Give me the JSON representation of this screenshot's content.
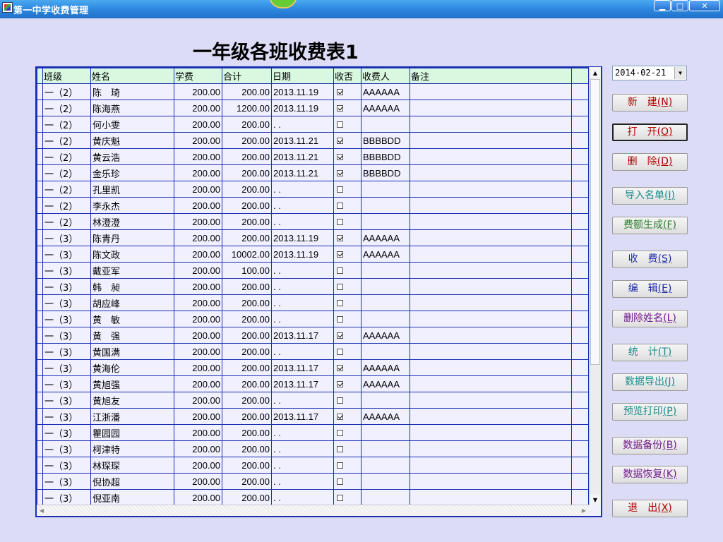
{
  "window": {
    "title": "第一中学收费管理",
    "minimize": "▁",
    "maximize": "□",
    "close": "✕"
  },
  "page_title": "一年级各班收费表1",
  "date_picker": {
    "value": "2014-02-21",
    "arrow": "▼"
  },
  "grid": {
    "columns": [
      "班级",
      "姓名",
      "学费",
      "合计",
      "日期",
      "收否",
      "收费人",
      "备注"
    ],
    "rows": [
      {
        "cls": "一（2）",
        "name": "陈　琦",
        "fee": "200.00",
        "total": "200.00",
        "date": "2013.11.19",
        "paid": true,
        "payer": "AAAAAA",
        "note": ""
      },
      {
        "cls": "一（2）",
        "name": "陈海燕",
        "fee": "200.00",
        "total": "1200.00",
        "date": "2013.11.19",
        "paid": true,
        "payer": "AAAAAA",
        "note": ""
      },
      {
        "cls": "一（2）",
        "name": "何小雯",
        "fee": "200.00",
        "total": "200.00",
        "date": ". .",
        "paid": false,
        "payer": "",
        "note": ""
      },
      {
        "cls": "一（2）",
        "name": "黄庆魁",
        "fee": "200.00",
        "total": "200.00",
        "date": "2013.11.21",
        "paid": true,
        "payer": "BBBBDD",
        "note": ""
      },
      {
        "cls": "一（2）",
        "name": "黄云浩",
        "fee": "200.00",
        "total": "200.00",
        "date": "2013.11.21",
        "paid": true,
        "payer": "BBBBDD",
        "note": ""
      },
      {
        "cls": "一（2）",
        "name": "金乐珍",
        "fee": "200.00",
        "total": "200.00",
        "date": "2013.11.21",
        "paid": true,
        "payer": "BBBBDD",
        "note": ""
      },
      {
        "cls": "一（2）",
        "name": "孔里凯",
        "fee": "200.00",
        "total": "200.00",
        "date": ". .",
        "paid": false,
        "payer": "",
        "note": ""
      },
      {
        "cls": "一（2）",
        "name": "李永杰",
        "fee": "200.00",
        "total": "200.00",
        "date": ". .",
        "paid": false,
        "payer": "",
        "note": ""
      },
      {
        "cls": "一（2）",
        "name": "林澄澄",
        "fee": "200.00",
        "total": "200.00",
        "date": ". .",
        "paid": false,
        "payer": "",
        "note": ""
      },
      {
        "cls": "一（3）",
        "name": "陈青丹",
        "fee": "200.00",
        "total": "200.00",
        "date": "2013.11.19",
        "paid": true,
        "payer": "AAAAAA",
        "note": ""
      },
      {
        "cls": "一（3）",
        "name": "陈文政",
        "fee": "200.00",
        "total": "10002.00",
        "date": "2013.11.19",
        "paid": true,
        "payer": "AAAAAA",
        "note": ""
      },
      {
        "cls": "一（3）",
        "name": "戴亚军",
        "fee": "200.00",
        "total": "100.00",
        "date": ". .",
        "paid": false,
        "payer": "",
        "note": ""
      },
      {
        "cls": "一（3）",
        "name": "韩　昶",
        "fee": "200.00",
        "total": "200.00",
        "date": ". .",
        "paid": false,
        "payer": "",
        "note": ""
      },
      {
        "cls": "一（3）",
        "name": "胡应峰",
        "fee": "200.00",
        "total": "200.00",
        "date": ". .",
        "paid": false,
        "payer": "",
        "note": ""
      },
      {
        "cls": "一（3）",
        "name": "黄　敏",
        "fee": "200.00",
        "total": "200.00",
        "date": ". .",
        "paid": false,
        "payer": "",
        "note": ""
      },
      {
        "cls": "一（3）",
        "name": "黄　强",
        "fee": "200.00",
        "total": "200.00",
        "date": "2013.11.17",
        "paid": true,
        "payer": "AAAAAA",
        "note": ""
      },
      {
        "cls": "一（3）",
        "name": "黄国满",
        "fee": "200.00",
        "total": "200.00",
        "date": ". .",
        "paid": false,
        "payer": "",
        "note": ""
      },
      {
        "cls": "一（3）",
        "name": "黄海伦",
        "fee": "200.00",
        "total": "200.00",
        "date": "2013.11.17",
        "paid": true,
        "payer": "AAAAAA",
        "note": ""
      },
      {
        "cls": "一（3）",
        "name": "黄旭强",
        "fee": "200.00",
        "total": "200.00",
        "date": "2013.11.17",
        "paid": true,
        "payer": "AAAAAA",
        "note": ""
      },
      {
        "cls": "一（3）",
        "name": "黄旭友",
        "fee": "200.00",
        "total": "200.00",
        "date": ". .",
        "paid": false,
        "payer": "",
        "note": ""
      },
      {
        "cls": "一（3）",
        "name": "江浙潘",
        "fee": "200.00",
        "total": "200.00",
        "date": "2013.11.17",
        "paid": true,
        "payer": "AAAAAA",
        "note": ""
      },
      {
        "cls": "一（3）",
        "name": "瞿园园",
        "fee": "200.00",
        "total": "200.00",
        "date": ". .",
        "paid": false,
        "payer": "",
        "note": ""
      },
      {
        "cls": "一（3）",
        "name": "柯津特",
        "fee": "200.00",
        "total": "200.00",
        "date": ". .",
        "paid": false,
        "payer": "",
        "note": ""
      },
      {
        "cls": "一（3）",
        "name": "林琛琛",
        "fee": "200.00",
        "total": "200.00",
        "date": ". .",
        "paid": false,
        "payer": "",
        "note": ""
      },
      {
        "cls": "一（3）",
        "name": "倪协超",
        "fee": "200.00",
        "total": "200.00",
        "date": ". .",
        "paid": false,
        "payer": "",
        "note": ""
      },
      {
        "cls": "一（3）",
        "name": "倪亚南",
        "fee": "200.00",
        "total": "200.00",
        "date": ". .",
        "paid": false,
        "payer": "",
        "note": ""
      }
    ]
  },
  "buttons": [
    {
      "id": "new",
      "label": "新　建",
      "key": "(N)",
      "color": "red",
      "focused": false
    },
    {
      "id": "open",
      "label": "打　开",
      "key": "(O)",
      "color": "red",
      "focused": true
    },
    {
      "id": "delete",
      "label": "删　除",
      "key": "(D)",
      "color": "red",
      "focused": false
    },
    {
      "id": "import-list",
      "label": "导入名单",
      "key": "(I)",
      "color": "teal",
      "focused": false
    },
    {
      "id": "fee-generate",
      "label": "费额生成",
      "key": "(F)",
      "color": "green",
      "focused": false
    },
    {
      "id": "charge",
      "label": "收　费",
      "key": "(S)",
      "color": "blue",
      "focused": false
    },
    {
      "id": "edit",
      "label": "编　辑",
      "key": "(E)",
      "color": "blue",
      "focused": false
    },
    {
      "id": "delete-name",
      "label": "删除姓名",
      "key": "(L)",
      "color": "purple",
      "focused": false
    },
    {
      "id": "stats",
      "label": "统　计",
      "key": "(T)",
      "color": "teal",
      "focused": false
    },
    {
      "id": "export",
      "label": "数据导出",
      "key": "(J)",
      "color": "teal",
      "focused": false
    },
    {
      "id": "preview-print",
      "label": "预览打印",
      "key": "(P)",
      "color": "teal",
      "focused": false
    },
    {
      "id": "backup",
      "label": "数据备份",
      "key": "(B)",
      "color": "purple",
      "focused": false
    },
    {
      "id": "restore",
      "label": "数据恢复",
      "key": "(K)",
      "color": "purple",
      "focused": false
    },
    {
      "id": "exit",
      "label": "退　出",
      "key": "(X)",
      "color": "red",
      "focused": false
    }
  ]
}
